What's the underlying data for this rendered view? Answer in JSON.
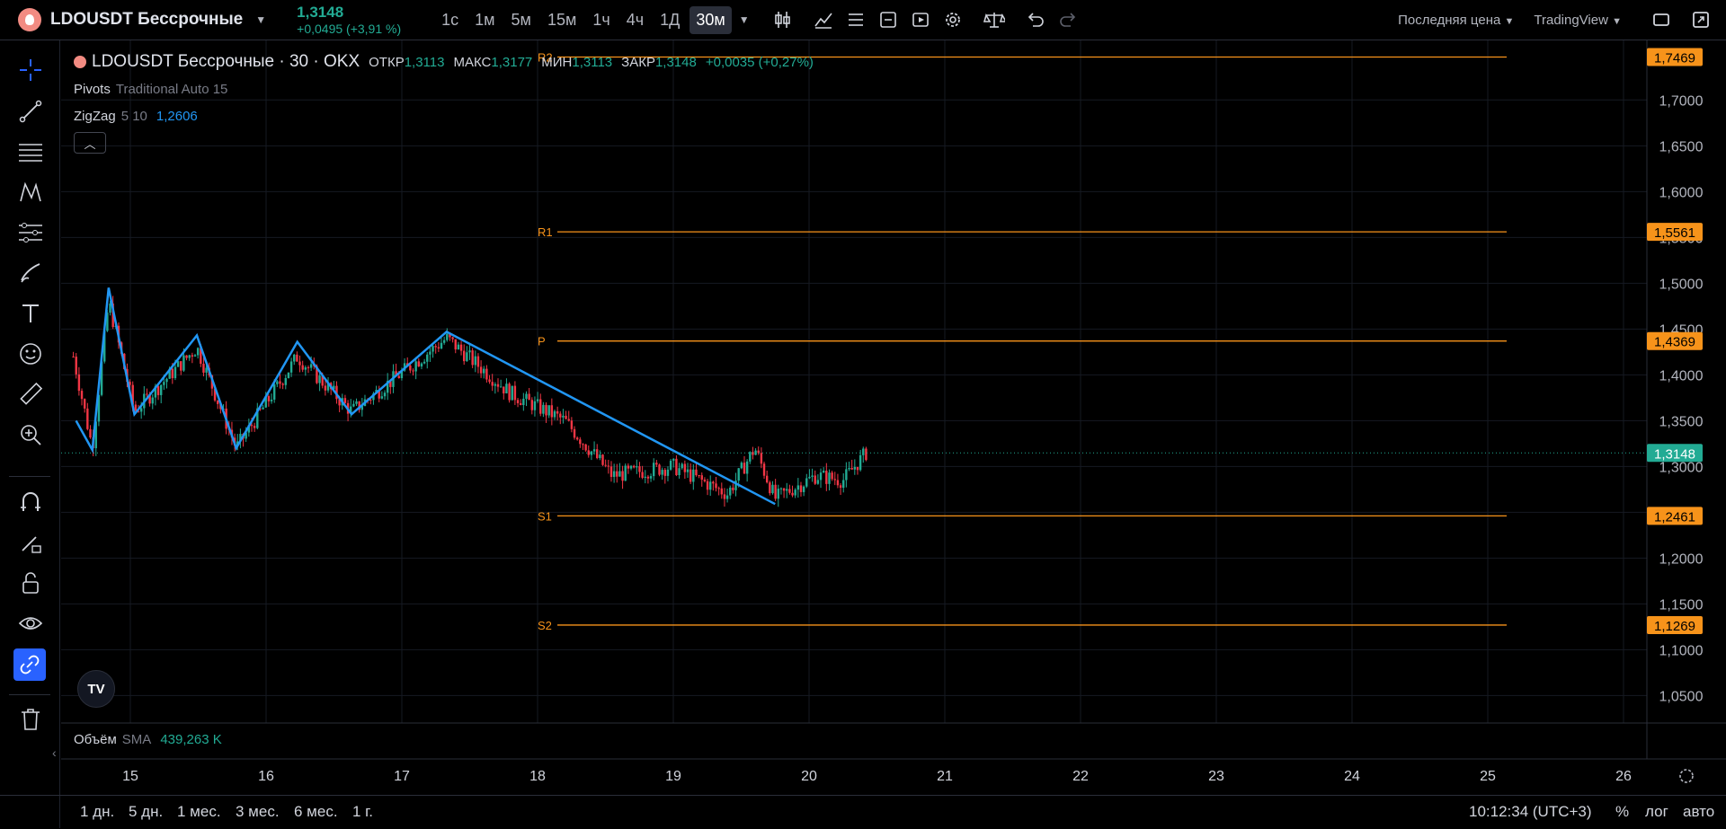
{
  "header": {
    "symbol": "LDOUSDT Бессрочные",
    "price": "1,3148",
    "change": "+0,0495 (+3,91 %)",
    "intervals": [
      {
        "label": "1с",
        "active": false
      },
      {
        "label": "1м",
        "active": false
      },
      {
        "label": "5м",
        "active": false
      },
      {
        "label": "15м",
        "active": false
      },
      {
        "label": "1ч",
        "active": false
      },
      {
        "label": "4ч",
        "active": false
      },
      {
        "label": "1Д",
        "active": false
      },
      {
        "label": "30м",
        "active": true
      }
    ],
    "price_type": "Последняя цена",
    "theme": "TradingView"
  },
  "legend": {
    "title": "LDOUSDT Бессрочные · 30 · OKX",
    "open_label": "ОТКР",
    "open": "1,3113",
    "high_label": "МАКС",
    "high": "1,3177",
    "low_label": "МИН",
    "low": "1,3113",
    "close_label": "ЗАКР",
    "close": "1,3148",
    "change": "+0,0035 (+0,27%)",
    "pivots_name": "Pivots",
    "pivots_params": "Traditional Auto 15",
    "zigzag_name": "ZigZag",
    "zigzag_params": "5 10",
    "zigzag_value": "1,2606"
  },
  "volume": {
    "name": "Объём",
    "ma": "SMA",
    "value": "439,263 K"
  },
  "bottom": {
    "ranges": [
      "1 дн.",
      "5 дн.",
      "1 мес.",
      "3 мес.",
      "6 мес.",
      "1 г."
    ],
    "clock": "10:12:34 (UTC+3)",
    "percent": "%",
    "log": "лог",
    "auto": "авто"
  },
  "colors": {
    "up": "#22ab94",
    "down": "#f23645",
    "zigzag": "#2196f3",
    "pivot": "#f7931a",
    "last": "#22ab94"
  },
  "chart_data": {
    "type": "candlestick",
    "ylim": [
      1.02,
      1.765
    ],
    "y_ticks": [
      "1,7000",
      "1,6500",
      "1,6000",
      "1,5500",
      "1,5000",
      "1,4500",
      "1,4000",
      "1,3500",
      "1,3000",
      "1,2500",
      "1,2000",
      "1,1500",
      "1,1000",
      "1,0500"
    ],
    "x_ticks": [
      "15",
      "16",
      "17",
      "18",
      "19",
      "20",
      "21",
      "22",
      "23",
      "24",
      "25",
      "26"
    ],
    "last_price": 1.3148,
    "last_label": "1,3148",
    "pivots": [
      {
        "name": "R2",
        "value": 1.7469,
        "label": "1,7469"
      },
      {
        "name": "R1",
        "value": 1.5561,
        "label": "1,5561"
      },
      {
        "name": "P",
        "value": 1.4369,
        "label": "1,4369"
      },
      {
        "name": "S1",
        "value": 1.2461,
        "label": "1,2461"
      },
      {
        "name": "S2",
        "value": 1.1269,
        "label": "1,1269"
      }
    ],
    "zigzag": [
      {
        "t": 14.6,
        "v": 1.35
      },
      {
        "t": 14.72,
        "v": 1.318
      },
      {
        "t": 14.84,
        "v": 1.495
      },
      {
        "t": 15.03,
        "v": 1.357
      },
      {
        "t": 15.49,
        "v": 1.443
      },
      {
        "t": 15.78,
        "v": 1.32
      },
      {
        "t": 16.23,
        "v": 1.436
      },
      {
        "t": 16.63,
        "v": 1.357
      },
      {
        "t": 17.33,
        "v": 1.447
      },
      {
        "t": 19.75,
        "v": 1.259
      }
    ],
    "anchors": [
      {
        "t": 14.58,
        "v": 1.42
      },
      {
        "t": 14.72,
        "v": 1.32
      },
      {
        "t": 14.84,
        "v": 1.48
      },
      {
        "t": 15.03,
        "v": 1.36
      },
      {
        "t": 15.49,
        "v": 1.43
      },
      {
        "t": 15.78,
        "v": 1.32
      },
      {
        "t": 16.23,
        "v": 1.42
      },
      {
        "t": 16.63,
        "v": 1.36
      },
      {
        "t": 17.33,
        "v": 1.44
      },
      {
        "t": 17.8,
        "v": 1.38
      },
      {
        "t": 18.2,
        "v": 1.35
      },
      {
        "t": 18.55,
        "v": 1.29
      },
      {
        "t": 19.0,
        "v": 1.3
      },
      {
        "t": 19.4,
        "v": 1.27
      },
      {
        "t": 19.6,
        "v": 1.32
      },
      {
        "t": 19.75,
        "v": 1.265
      },
      {
        "t": 20.05,
        "v": 1.29
      },
      {
        "t": 20.25,
        "v": 1.285
      },
      {
        "t": 20.42,
        "v": 1.3148
      }
    ]
  }
}
